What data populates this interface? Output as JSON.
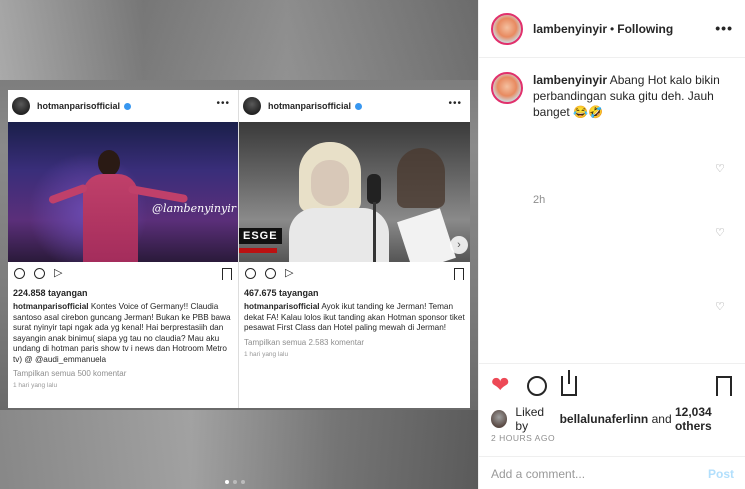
{
  "post": {
    "left_card": {
      "username": "hotmanparisofficial",
      "watermark": "@lambenyinyir",
      "views": "224.858 tayangan",
      "caption_user": "hotmanparisofficial",
      "caption_text": "Kontes Voice of Germany!! Claudia santoso asal cirebon guncang Jerman! Bukan ke PBB bawa surat nyinyir tapi ngak ada yg kenal! Hai berprestasiih dan sayangin anak binimu( siapa yg tau no claudia? Mau aku undang di hotman paris show tv i news dan Hotroom Metro tv) @ @audi_emmanuela",
      "comments_link": "Tampilkan semua 500 komentar",
      "time": "1 hari yang lalu"
    },
    "right_card": {
      "username": "hotmanparisofficial",
      "overlay_logo": "ESGE",
      "views": "467.675 tayangan",
      "caption_user": "hotmanparisofficial",
      "caption_text": "Ayok ikut tanding ke Jerman! Teman dekat FA! Kalau lolos ikut tanding akan Hotman sponsor tiket pesawat First Class dan Hotel paling mewah di Jerman!",
      "comments_link": "Tampilkan semua 2.583 komentar",
      "time": "1 hari yang lalu"
    }
  },
  "sidebar": {
    "username": "lambenyinyir",
    "separator": "•",
    "follow_status": "Following",
    "more": "•••",
    "comment": {
      "username": "lambenyinyir",
      "text": "Abang Hot kalo bikin perbandingan suka gitu deh. Jauh banget 😂🤣",
      "time": "2h"
    },
    "likes": {
      "prefix": "Liked by",
      "user": "bellalunaferlinn",
      "middle": "and",
      "count": "12,034 others"
    },
    "posted_ago": "2 HOURS AGO",
    "add_comment_placeholder": "Add a comment...",
    "post_button": "Post"
  }
}
